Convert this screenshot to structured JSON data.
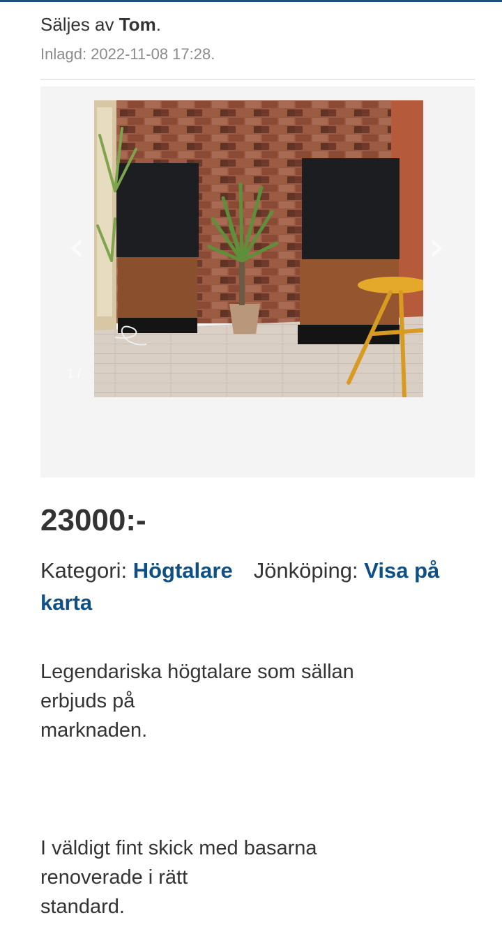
{
  "listing": {
    "seller_prefix": "Säljes av ",
    "seller_name": "Tom",
    "seller_suffix": ".",
    "posted": "Inlagd: 2022-11-08 17:28."
  },
  "gallery": {
    "photo_alt": "Högtalare",
    "prev_icon": "chevron-left-icon",
    "next_icon": "chevron-right-icon",
    "counter": "1 /"
  },
  "price": "23000:-",
  "meta": {
    "category_label": "Kategori: ",
    "category_link": "Högtalare",
    "location_label": "Jönköping: ",
    "map_link": "Visa på karta"
  },
  "description": {
    "paragraph1": [
      "Legendariska högtalare som sällan",
      "erbjuds på",
      "marknaden."
    ],
    "paragraph2": [
      "I väldigt fint skick med basarna",
      "renoverade i rätt",
      "standard."
    ]
  },
  "colors": {
    "accent": "#1f4f7f",
    "link": "#0e4f86"
  }
}
